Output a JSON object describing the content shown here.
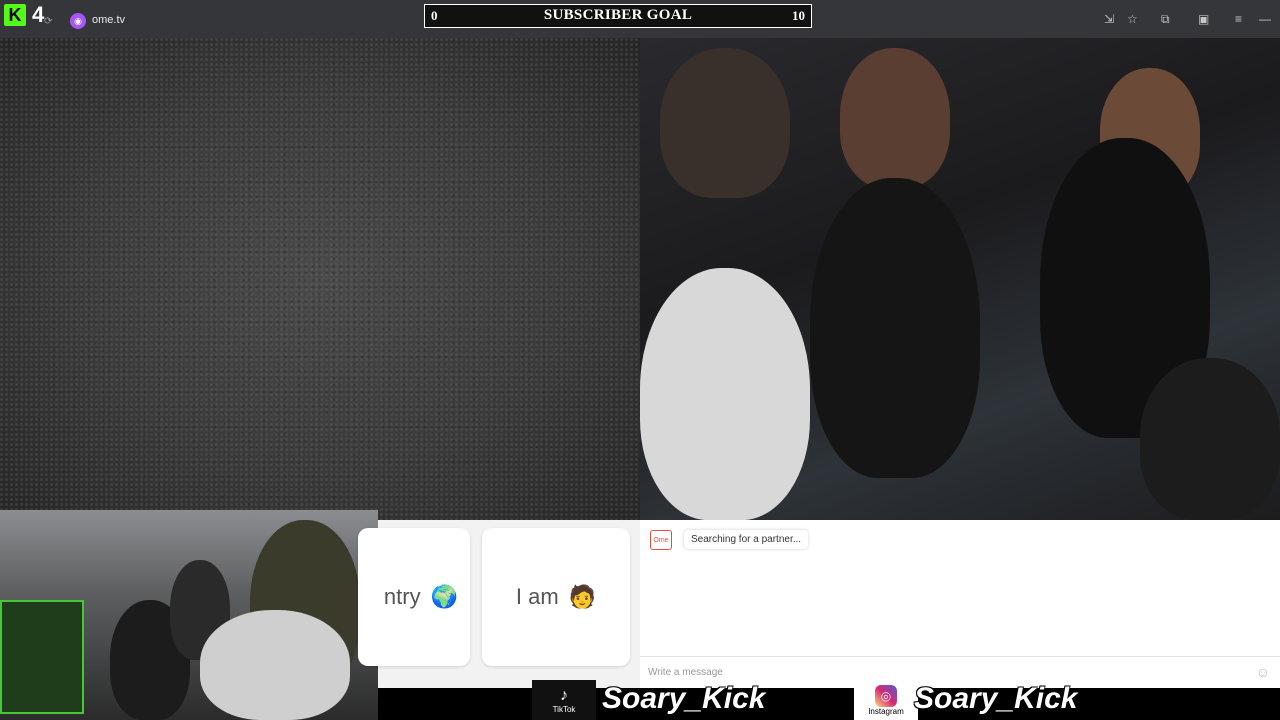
{
  "browser": {
    "kick_count": "4",
    "url": "ome.tv"
  },
  "goal": {
    "start": "0",
    "label": "SUBSCRIBER GOAL",
    "end": "10"
  },
  "cards": {
    "country_label": "ntry",
    "country_emoji": "🌍",
    "iam_label": "I am",
    "iam_emoji": "🧑"
  },
  "chat": {
    "status_text": "Searching for a partner...",
    "input_placeholder": "Write a message"
  },
  "social": {
    "tiktok_label": "TikTok",
    "tiktok_handle": "Soary_Kick",
    "instagram_label": "Instagram",
    "instagram_handle": "Soary_Kick"
  },
  "colors": {
    "kick_green": "#53fc18",
    "topbar": "#35363a"
  }
}
